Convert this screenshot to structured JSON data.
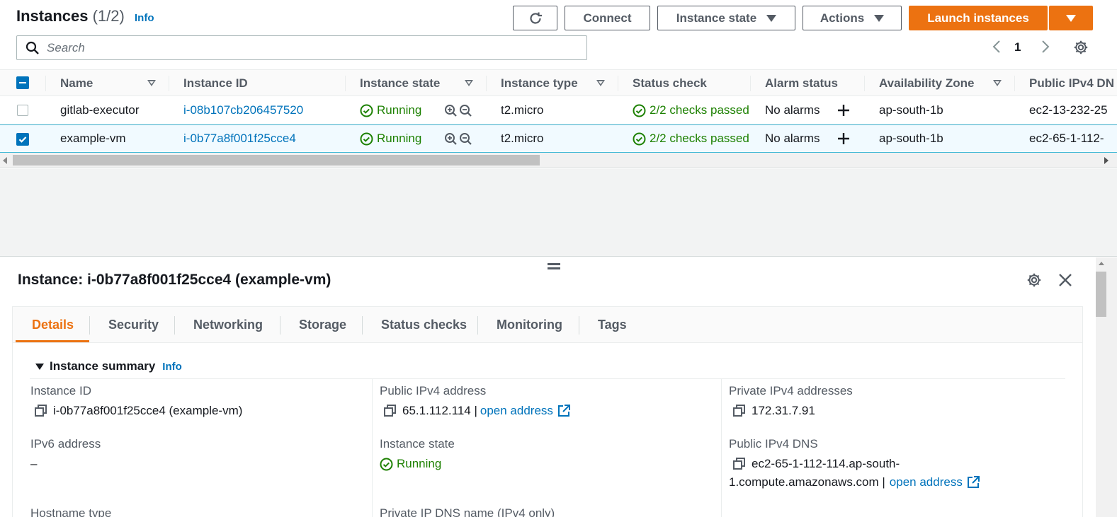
{
  "header": {
    "title": "Instances",
    "count": "(1/2)",
    "info": "Info",
    "buttons": {
      "connect": "Connect",
      "instance_state": "Instance state",
      "actions": "Actions",
      "launch": "Launch instances"
    },
    "search_placeholder": "Search",
    "page": "1"
  },
  "table": {
    "columns": [
      "Name",
      "Instance ID",
      "Instance state",
      "Instance type",
      "Status check",
      "Alarm status",
      "Availability Zone",
      "Public IPv4 DN"
    ],
    "rows": [
      {
        "name": "gitlab-executor",
        "instance_id": "i-08b107cb206457520",
        "state": "Running",
        "type": "t2.micro",
        "status_check": "2/2 checks passed",
        "alarm": "No alarms",
        "az": "ap-south-1b",
        "dns": "ec2-13-232-25",
        "selected": false
      },
      {
        "name": "example-vm",
        "instance_id": "i-0b77a8f001f25cce4",
        "state": "Running",
        "type": "t2.micro",
        "status_check": "2/2 checks passed",
        "alarm": "No alarms",
        "az": "ap-south-1b",
        "dns": "ec2-65-1-112-",
        "selected": true
      }
    ]
  },
  "details": {
    "title": "Instance: i-0b77a8f001f25cce4 (example-vm)",
    "tabs": [
      "Details",
      "Security",
      "Networking",
      "Storage",
      "Status checks",
      "Monitoring",
      "Tags"
    ],
    "active_tab": "Details",
    "section": "Instance summary",
    "section_info": "Info",
    "fields": {
      "instance_id_label": "Instance ID",
      "instance_id_value": "i-0b77a8f001f25cce4 (example-vm)",
      "public_ipv4_label": "Public IPv4 address",
      "public_ipv4_value": "65.1.112.114 |",
      "open_address": "open address",
      "private_ipv4_label": "Private IPv4 addresses",
      "private_ipv4_value": "172.31.7.91",
      "ipv6_label": "IPv6 address",
      "ipv6_value": "–",
      "state_label": "Instance state",
      "state_value": "Running",
      "public_dns_label": "Public IPv4 DNS",
      "public_dns_line1": "ec2-65-1-112-114.ap-south-",
      "public_dns_line2": "1.compute.amazonaws.com |",
      "hostname_type_label": "Hostname type",
      "private_dns_label": "Private IP DNS name (IPv4 only)"
    }
  },
  "colors": {
    "accent": "#ec7211",
    "link": "#0073bb",
    "success": "#1d8102"
  }
}
